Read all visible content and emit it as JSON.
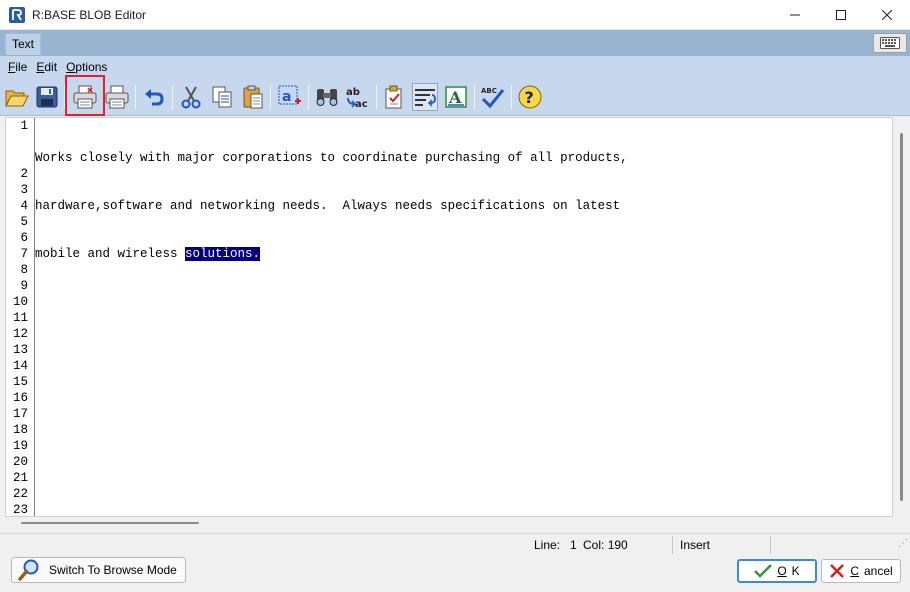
{
  "window": {
    "title": "R:BASE BLOB Editor"
  },
  "tab": {
    "label": "Text"
  },
  "menu": {
    "items": [
      {
        "accel": "F",
        "rest": "ile"
      },
      {
        "accel": "E",
        "rest": "dit"
      },
      {
        "accel": "O",
        "rest": "ptions"
      }
    ]
  },
  "toolbar": {
    "icons": [
      "open-folder-icon",
      "save-icon",
      "print-preview-icon",
      "print-icon",
      "undo-icon",
      "cut-icon",
      "copy-icon",
      "paste-icon",
      "select-all-icon",
      "find-icon",
      "replace-icon",
      "insert-file-icon",
      "word-wrap-icon",
      "font-icon",
      "spell-check-icon",
      "help-icon"
    ],
    "highlighted": "print-preview-icon"
  },
  "editor": {
    "line_numbers": [
      "1",
      "2",
      "3",
      "4",
      "5",
      "6",
      "7",
      "8",
      "9",
      "10",
      "11",
      "12",
      "13",
      "14",
      "15",
      "16",
      "17",
      "18",
      "19",
      "20",
      "21",
      "22",
      "23"
    ],
    "text_lines": [
      "Works closely with major corporations to coordinate purchasing of all products,",
      "hardware,software and networking needs.  Always needs specifications on latest",
      "mobile and wireless "
    ],
    "selected_text": "solutions.",
    "selection_color": "#000080"
  },
  "status": {
    "line_label": "Line:",
    "line_value": "1",
    "col_label": "Col:",
    "col_value": "190",
    "mode": "Insert"
  },
  "buttons": {
    "browse": "Switch To Browse Mode",
    "ok_accel": "O",
    "ok_rest": "K",
    "cancel_accel": "C",
    "cancel_rest": "ancel"
  },
  "colors": {
    "tab_bar": "#99b4d1",
    "toolbar": "#c6d7ee",
    "highlight_box": "#e0202a",
    "default_button_border": "#3c8bd8"
  }
}
